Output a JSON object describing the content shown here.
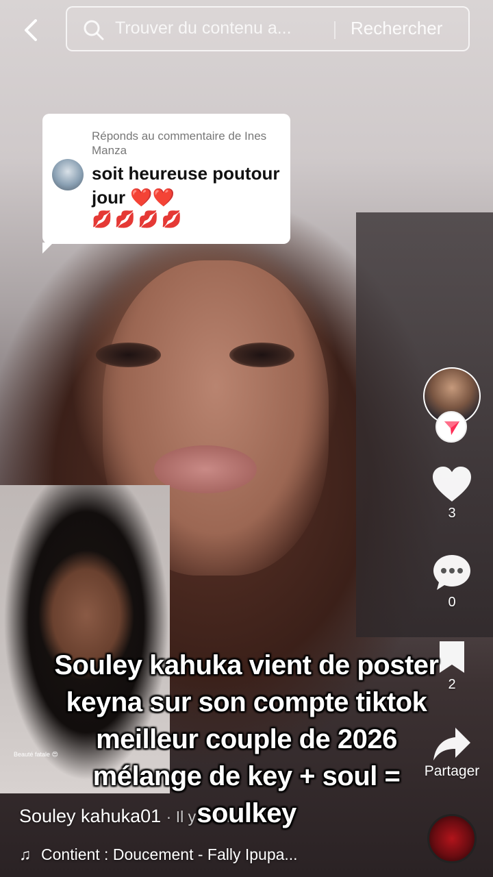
{
  "search": {
    "placeholder": "Trouver du contenu a...",
    "button_label": "Rechercher"
  },
  "reply": {
    "header": "Réponds au commentaire de Ines Manza",
    "text": "soit heureuse poutour jour ❤️❤️",
    "emojis": "💋💋💋💋"
  },
  "rail": {
    "likes": "3",
    "comments": "0",
    "saves": "2",
    "share_label": "Partager"
  },
  "inset": {
    "tag": "Beauté fatale 😍"
  },
  "caption": {
    "lines": [
      "Souley kahuka vient de poster",
      "keyna sur son compte tiktok",
      "meilleur couple de 2026",
      "mélange de key + soul =",
      "soulkey"
    ]
  },
  "video": {
    "author": "Souley kahuka01",
    "time": "· Il y a 1 h",
    "music": "Contient : Doucement - Fally Ipupa..."
  },
  "colors": {
    "heart": "#ffffff",
    "follow_badge": "#fe2c55"
  }
}
